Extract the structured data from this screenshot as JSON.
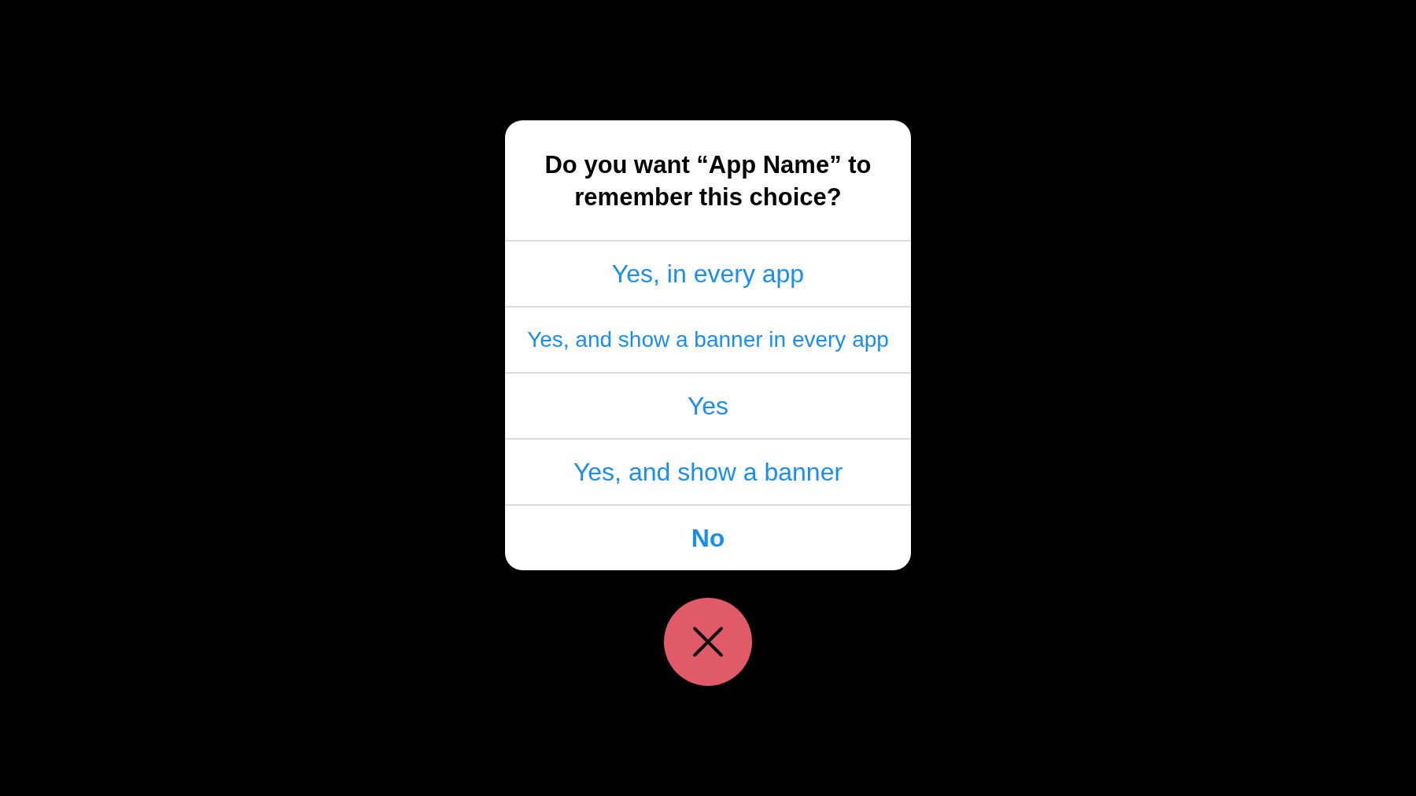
{
  "alert": {
    "title": "Do you want “App Name” to remember this choice?",
    "options": [
      {
        "label": "Yes, in every app",
        "kind": "default"
      },
      {
        "label": "Yes, and show a banner in every app",
        "kind": "default"
      },
      {
        "label": "Yes",
        "kind": "default"
      },
      {
        "label": "Yes, and show a banner",
        "kind": "default"
      },
      {
        "label": "No",
        "kind": "cancel"
      }
    ]
  },
  "close_button": {
    "kind": "close"
  }
}
